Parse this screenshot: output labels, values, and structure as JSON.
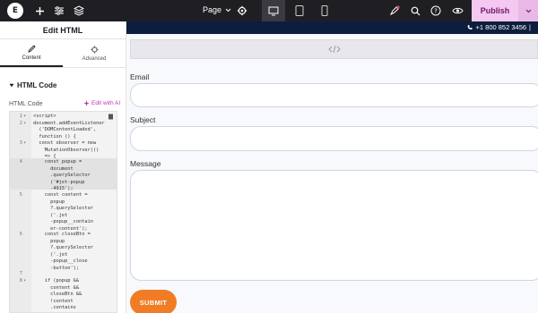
{
  "topbar": {
    "logo_glyph": "E",
    "page_label": "Page",
    "publish_label": "Publish"
  },
  "panel": {
    "title": "Edit HTML",
    "tabs": [
      {
        "label": "Content",
        "icon": "pencil-icon",
        "active": true
      },
      {
        "label": "Advanced",
        "icon": "gear-icon",
        "active": false
      }
    ],
    "section_title": "HTML Code",
    "field_label": "HTML Code",
    "ai_link": "Edit with AI"
  },
  "editor": {
    "lines": [
      {
        "n": "1",
        "fold": "▾",
        "text": "<script>"
      },
      {
        "n": "2",
        "fold": "▾",
        "text": "document.addEventListener\n  ('DOMContentLoaded',\n  function () {"
      },
      {
        "n": "3",
        "fold": "▾",
        "text": "  const observer = new\n    MutationObserver(()\n    => {"
      },
      {
        "n": "4",
        "fold": "",
        "text": "    const popup =\n      document\n      .querySelector\n      ('#jet-popup\n      -4915');"
      },
      {
        "n": "5",
        "fold": "",
        "text": "    const content =\n      popup\n      ?.querySelector\n      ('.jet\n      -popup__contain\n      er-content');"
      },
      {
        "n": "6",
        "fold": "",
        "text": "    const closeBtn =\n      popup\n      ?.querySelector\n      ('.jet\n      -popup__close\n      -button');"
      },
      {
        "n": "7",
        "fold": "",
        "text": ""
      },
      {
        "n": "8",
        "fold": "▾",
        "text": "    if (popup &&\n      content &&\n      closeBtn &&\n      !content\n      .contains\n      (closeBtn)) {"
      }
    ]
  },
  "preview": {
    "phone": "+1 800 852 3456",
    "separator": "|",
    "form": {
      "email_label": "Email",
      "subject_label": "Subject",
      "message_label": "Message",
      "submit_label": "SUBMIT"
    }
  },
  "colors": {
    "topbar": "#1f1f23",
    "publish": "#f4c8f1",
    "accent_orange": "#f07d26",
    "phone_bar": "#0c1e3e",
    "ai_link": "#c036b5"
  }
}
